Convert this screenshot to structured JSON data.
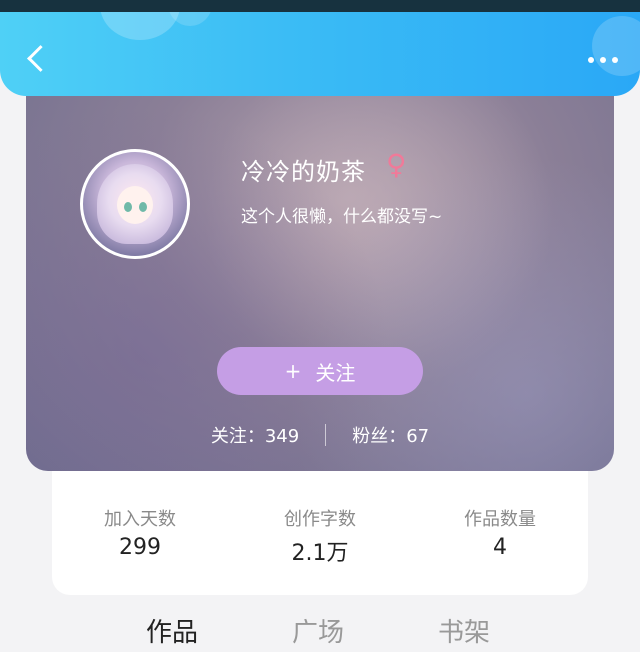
{
  "header": {
    "back_icon": "chevron-left-icon",
    "more_icon": "more-dots-icon"
  },
  "profile": {
    "username": "冷冷的奶茶",
    "gender_icon": "female-icon",
    "gender_symbol": "♀",
    "bio": "这个人很懒，什么都没写~",
    "follow_plus": "+",
    "follow_label": "关注",
    "following": "关注：349",
    "fans": "粉丝：67"
  },
  "stats": [
    {
      "label": "加入天数",
      "value": "299"
    },
    {
      "label": "创作字数",
      "value": "2.1万"
    },
    {
      "label": "作品数量",
      "value": "4"
    }
  ],
  "tabs": [
    {
      "label": "作品"
    },
    {
      "label": "广场"
    },
    {
      "label": "书架"
    }
  ],
  "colors": {
    "header": "#3bbcf5",
    "follow_button": "#c59ee5",
    "gender": "#f07a99"
  }
}
